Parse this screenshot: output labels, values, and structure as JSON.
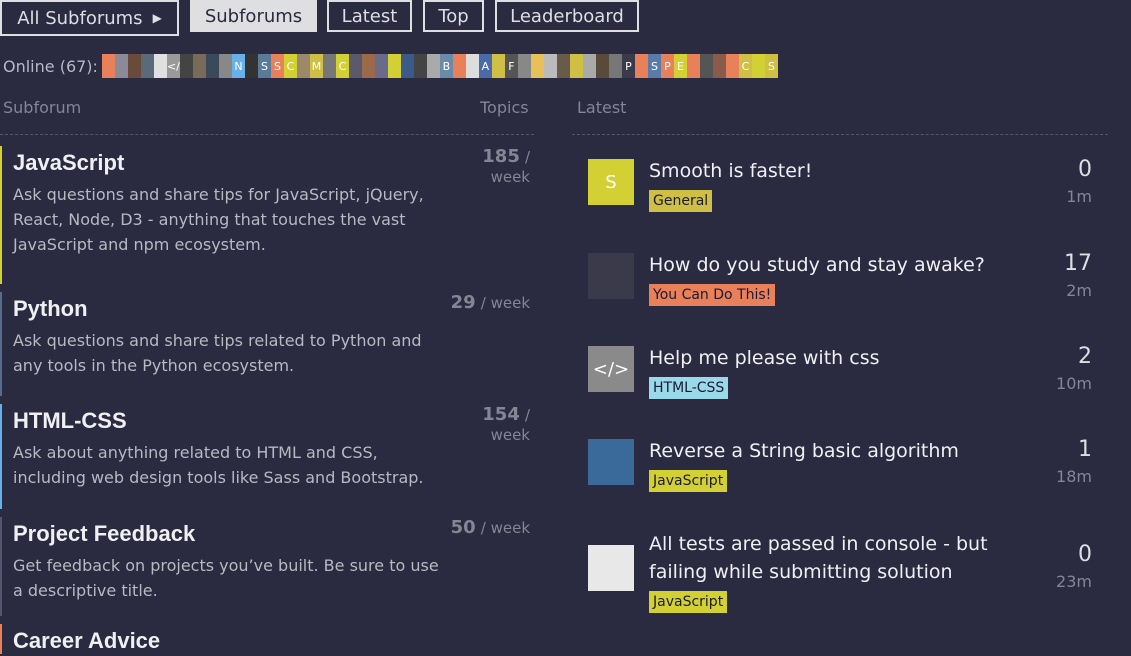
{
  "nav": {
    "all_subforums": "All Subforums",
    "subforums": "Subforums",
    "latest": "Latest",
    "top": "Top",
    "leaderboard": "Leaderboard"
  },
  "online": {
    "label": "Online (67):",
    "avatars": [
      {
        "c": "#e8805a",
        "t": ""
      },
      {
        "c": "#8a8a99",
        "t": ""
      },
      {
        "c": "#6a4a3a",
        "t": ""
      },
      {
        "c": "#5a6a7a",
        "t": ""
      },
      {
        "c": "#e0e0e0",
        "t": ""
      },
      {
        "c": "#9a9a9a",
        "t": "</"
      },
      {
        "c": "#444",
        "t": ""
      },
      {
        "c": "#7a6a5a",
        "t": ""
      },
      {
        "c": "#3a4a5a",
        "t": ""
      },
      {
        "c": "#888",
        "t": ""
      },
      {
        "c": "#6ab0e8",
        "t": "N"
      },
      {
        "c": "#333",
        "t": ""
      },
      {
        "c": "#5a7a9a",
        "t": "S"
      },
      {
        "c": "#e8805a",
        "t": "S"
      },
      {
        "c": "#d3d034",
        "t": "C"
      },
      {
        "c": "#9a8a6a",
        "t": ""
      },
      {
        "c": "#cfc045",
        "t": "M"
      },
      {
        "c": "#777",
        "t": ""
      },
      {
        "c": "#d3d034",
        "t": "C"
      },
      {
        "c": "#5a5a6a",
        "t": ""
      },
      {
        "c": "#9a6a4a",
        "t": ""
      },
      {
        "c": "#6a6a8a",
        "t": ""
      },
      {
        "c": "#d3d034",
        "t": ""
      },
      {
        "c": "#3a5a8a",
        "t": ""
      },
      {
        "c": "#444",
        "t": ""
      },
      {
        "c": "#aaa",
        "t": ""
      },
      {
        "c": "#6a8aaa",
        "t": "B"
      },
      {
        "c": "#e8805a",
        "t": ""
      },
      {
        "c": "#ddd",
        "t": ""
      },
      {
        "c": "#4a6aaa",
        "t": "A"
      },
      {
        "c": "#cfc045",
        "t": ""
      },
      {
        "c": "#555",
        "t": "F"
      },
      {
        "c": "#888",
        "t": ""
      },
      {
        "c": "#e8c05a",
        "t": ""
      },
      {
        "c": "#bbb",
        "t": ""
      },
      {
        "c": "#6a5a4a",
        "t": ""
      },
      {
        "c": "#cfc045",
        "t": ""
      },
      {
        "c": "#aaa",
        "t": ""
      },
      {
        "c": "#5a4a3a",
        "t": ""
      },
      {
        "c": "#777",
        "t": ""
      },
      {
        "c": "#3a3a4a",
        "t": "P"
      },
      {
        "c": "#e8805a",
        "t": ""
      },
      {
        "c": "#5a7aaa",
        "t": "S"
      },
      {
        "c": "#e8805a",
        "t": "P"
      },
      {
        "c": "#d3d034",
        "t": "E"
      },
      {
        "c": "#e8805a",
        "t": ""
      },
      {
        "c": "#555",
        "t": ""
      },
      {
        "c": "#8a5a4a",
        "t": ""
      },
      {
        "c": "#e8805a",
        "t": ""
      },
      {
        "c": "#cfc045",
        "t": "C"
      },
      {
        "c": "#d3d034",
        "t": ""
      },
      {
        "c": "#cfc045",
        "t": "S"
      }
    ]
  },
  "left": {
    "heading": "Subforum",
    "count_heading": "Topics",
    "items": [
      {
        "title": "JavaScript",
        "desc": "Ask questions and share tips for JavaScript, jQuery, React, Node, D3 - anything that touches the vast JavaScript and npm ecosystem.",
        "num": "185",
        "per": "/ week",
        "color": "#d3d034"
      },
      {
        "title": "Python",
        "desc": "Ask questions and share tips related to Python and any tools in the Python ecosystem.",
        "num": "29",
        "per": "/ week",
        "color": "#5a6a8a"
      },
      {
        "title": "HTML-CSS",
        "desc": "Ask about anything related to HTML and CSS, including web design tools like Sass and Bootstrap.",
        "num": "154",
        "per": "/ week",
        "color": "#6ab0e8"
      },
      {
        "title": "Project Feedback",
        "desc": "Get feedback on projects you’ve built. Be sure to use a descriptive title.",
        "num": "50",
        "per": "/ week",
        "color": "#555570"
      },
      {
        "title": "Career Advice",
        "desc": "",
        "num": "",
        "per": "",
        "color": "#e8805a"
      }
    ]
  },
  "right": {
    "heading": "Latest",
    "topics": [
      {
        "title": "Smooth is faster!",
        "tag": "General",
        "tag_color": "#cfc045",
        "replies": "0",
        "age": "1m",
        "thumb_letter": "S",
        "thumb_color": "#d3d034"
      },
      {
        "title": "How do you study and stay awake?",
        "tag": "You Can Do This!",
        "tag_color": "#e8805a",
        "replies": "17",
        "age": "2m",
        "thumb_letter": "",
        "thumb_color": "#3a3a4a"
      },
      {
        "title": "Help me please with css",
        "tag": "HTML-CSS",
        "tag_color": "#99d9ea",
        "replies": "2",
        "age": "10m",
        "thumb_letter": "</>",
        "thumb_color": "#8a8a8a"
      },
      {
        "title": "Reverse a String basic algorithm",
        "tag": "JavaScript",
        "tag_color": "#d3d034",
        "replies": "1",
        "age": "18m",
        "thumb_letter": "",
        "thumb_color": "#3a6a9a"
      },
      {
        "title": "All tests are passed in console - but failing while submitting solution",
        "tag": "JavaScript",
        "tag_color": "#d3d034",
        "replies": "0",
        "age": "23m",
        "thumb_letter": "",
        "thumb_color": "#e8e8e8"
      }
    ]
  }
}
